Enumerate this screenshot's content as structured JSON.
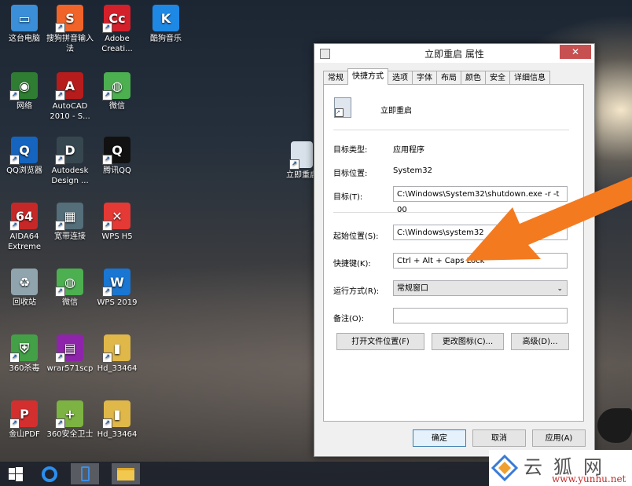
{
  "desktop": {
    "icons": [
      {
        "label": "这台电脑",
        "color": "#3a8fd8",
        "glyph": "▭"
      },
      {
        "label": "搜狗拼音输入法",
        "color": "#f0642a",
        "glyph": "S"
      },
      {
        "label": "Adobe Creati...",
        "color": "#d4202a",
        "glyph": "Cc"
      },
      {
        "label": "酷狗音乐",
        "color": "#1e88e5",
        "glyph": "K"
      },
      {
        "label": "网络",
        "color": "#2e7d32",
        "glyph": "◉"
      },
      {
        "label": "AutoCAD 2010 - S...",
        "color": "#b71c1c",
        "glyph": "A"
      },
      {
        "label": "微信",
        "color": "#4caf50",
        "glyph": "◍"
      },
      {
        "label": "QQ浏览器",
        "color": "#1565c0",
        "glyph": "Q"
      },
      {
        "label": "Autodesk Design ...",
        "color": "#37474f",
        "glyph": "D"
      },
      {
        "label": "腾讯QQ",
        "color": "#111111",
        "glyph": "Q"
      },
      {
        "label": "AIDA64 Extreme",
        "color": "#c62828",
        "glyph": "64"
      },
      {
        "label": "宽带连接",
        "color": "#546e7a",
        "glyph": "▦"
      },
      {
        "label": "WPS H5",
        "color": "#e53935",
        "glyph": "✕"
      },
      {
        "label": "回收站",
        "color": "#90a4ae",
        "glyph": "♻"
      },
      {
        "label": "微信",
        "color": "#4caf50",
        "glyph": "◍"
      },
      {
        "label": "WPS 2019",
        "color": "#1976d2",
        "glyph": "W"
      },
      {
        "label": "360杀毒",
        "color": "#43a047",
        "glyph": "⛨"
      },
      {
        "label": "wrar571scp",
        "color": "#8e24aa",
        "glyph": "▤"
      },
      {
        "label": "Hd_33464",
        "color": "#e0b84a",
        "glyph": "▮"
      },
      {
        "label": "金山PDF",
        "color": "#d32f2f",
        "glyph": "P"
      },
      {
        "label": "360安全卫士",
        "color": "#7cb342",
        "glyph": "+"
      },
      {
        "label": "Hd_33464",
        "color": "#e0b84a",
        "glyph": "▮"
      }
    ],
    "shortcut_label": "立即重启"
  },
  "dialog": {
    "title": "立即重启 属性",
    "close_label": "✕",
    "tabs": [
      "常规",
      "快捷方式",
      "选项",
      "字体",
      "布局",
      "颜色",
      "安全",
      "详细信息"
    ],
    "active_tab": "快捷方式",
    "name": "立即重启",
    "target_type_label": "目标类型:",
    "target_type_value": "应用程序",
    "target_location_label": "目标位置:",
    "target_location_value": "System32",
    "target_label": "目标(T):",
    "target_value": "C:\\Windows\\System32\\shutdown.exe -r -t 00",
    "start_in_label": "起始位置(S):",
    "start_in_value": "C:\\Windows\\system32",
    "hotkey_label": "快捷键(K):",
    "hotkey_value": "Ctrl + Alt + Caps Lock",
    "run_label": "运行方式(R):",
    "run_value": "常规窗口",
    "comment_label": "备注(O):",
    "comment_value": "",
    "open_location_button": "打开文件位置(F)",
    "change_icon_button": "更改图标(C)...",
    "advanced_button": "高级(D)...",
    "ok_button": "确定",
    "cancel_button": "取消",
    "apply_button": "应用(A)"
  },
  "watermark": {
    "brand": "云狐网",
    "url": "www.yunhu.net"
  },
  "colors": {
    "arrow": "#f47a20",
    "close_button": "#c75050"
  }
}
